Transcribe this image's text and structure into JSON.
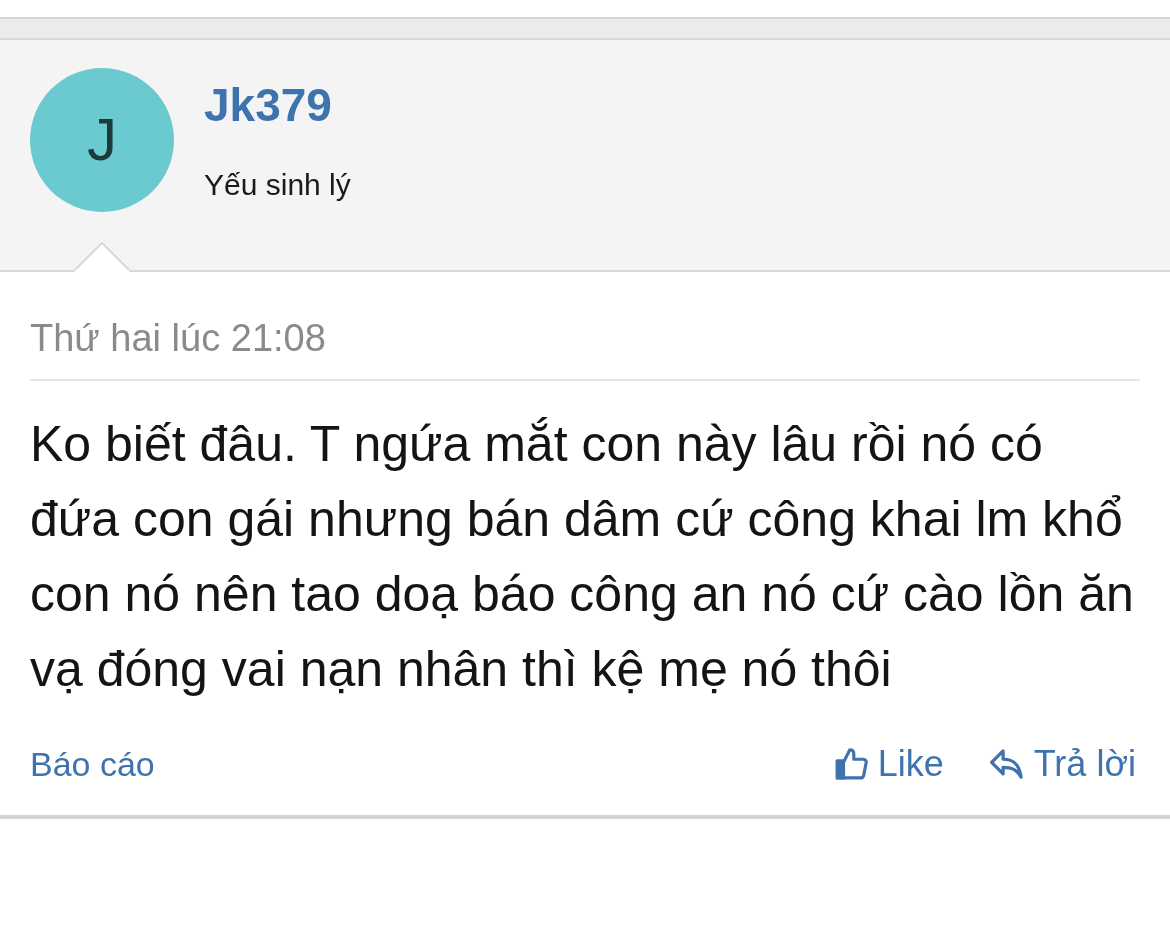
{
  "post": {
    "author": {
      "initial": "J",
      "name": "Jk379",
      "title": "Yếu sinh lý"
    },
    "time": "Thứ hai lúc 21:08",
    "body": "Ko biết đâu. T ngứa mắt con này lâu rồi nó có đứa con gái nhưng bán dâm cứ công khai lm khổ con nó nên tao doạ báo công an nó cứ cào lồn ăn vạ đóng vai nạn nhân thì kệ mẹ nó thôi",
    "report": "Báo cáo",
    "actions": [
      {
        "kind": "like",
        "label": "Like"
      },
      {
        "kind": "reply",
        "label": "Trả lời"
      }
    ]
  }
}
